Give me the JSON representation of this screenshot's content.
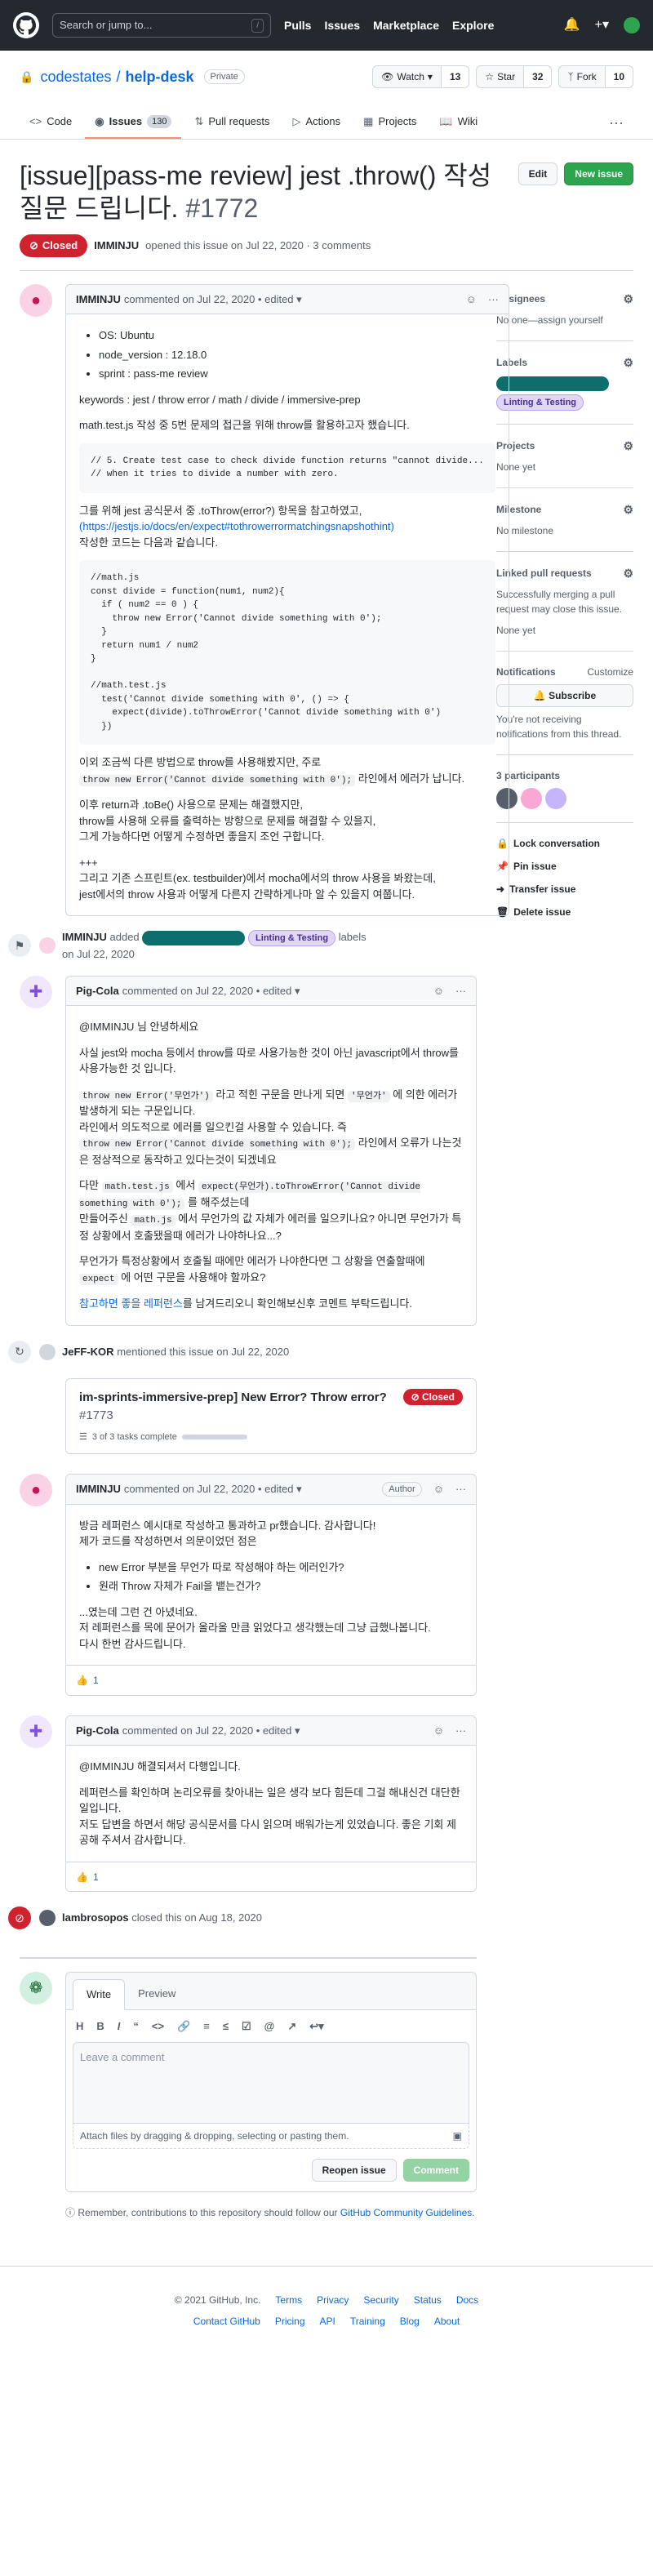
{
  "header": {
    "search_placeholder": "Search or jump to...",
    "search_key": "/",
    "nav": [
      "Pulls",
      "Issues",
      "Marketplace",
      "Explore"
    ]
  },
  "repo": {
    "owner": "codestates",
    "separator": "/",
    "name": "help-desk",
    "visibility": "Private",
    "watch_label": "Watch",
    "watch_count": "13",
    "star_label": "Star",
    "star_count": "32",
    "fork_label": "Fork",
    "fork_count": "10",
    "tabs": [
      {
        "label": "Code"
      },
      {
        "label": "Issues",
        "count": "130"
      },
      {
        "label": "Pull requests"
      },
      {
        "label": "Actions"
      },
      {
        "label": "Projects"
      },
      {
        "label": "Wiki"
      }
    ]
  },
  "issue": {
    "title": "[issue][pass-me review] jest .throw() 작성 질문 드립니다.",
    "number": "#1772",
    "edit_label": "Edit",
    "new_issue_label": "New issue",
    "state": "Closed",
    "author": "IMMINJU",
    "opened_text": "opened this issue on Jul 22, 2020 · 3 comments"
  },
  "comments": [
    {
      "author": "IMMINJU",
      "meta": "commented on Jul 22, 2020 • edited",
      "bullets": [
        "OS: Ubuntu",
        "node_version : 12.18.0",
        "sprint : pass-me review"
      ],
      "p1": "keywords : jest / throw error / math / divide / immersive-prep",
      "p2": "math.test.js 작성 중 5번 문제의 접근을 위해 throw를 활용하고자 했습니다.",
      "code1": "// 5. Create test case to check divide function returns \"cannot divide...\n// when it tries to divide a number with zero.",
      "p3a": "그를 위해 jest 공식문서 중 .toThrow(error?) 항목을 참고하였고,",
      "p3link": "(https://jestjs.io/docs/en/expect#tothrowerrormatchingsnapshothint)",
      "p3b": "작성한 코드는 다음과 같습니다.",
      "code2": "//math.js\nconst divide = function(num1, num2){\n  if ( num2 == 0 ) {\n    throw new Error('Cannot divide something with 0');\n  }\n  return num1 / num2\n}\n\n//math.test.js\n  test('Cannot divide something with 0', () => {\n    expect(divide).toThrowError('Cannot divide something with 0')\n  })",
      "p4a": "이외 조금씩 다른 방법으로 throw를 사용해봤지만, 주로",
      "p4code": "throw new Error('Cannot divide something with 0');",
      "p4b": "라인에서 에러가 납니다.",
      "p5": "이후 return과 .toBe() 사용으로 문제는 해결했지만,\nthrow를 사용해 오류를 출력하는 방향으로 문제를 해결할 수 있을지,\n그게 가능하다면 어떻게 수정하면 좋을지 조언 구합니다.",
      "p6": "+++\n그리고 기존 스프린트(ex. testbuilder)에서 mocha에서의 throw 사용을 봐왔는데,\njest에서의 throw 사용과 어떻게 다른지 간략하게나마 알 수 있을지 여쭙니다."
    },
    {
      "author": "Pig-Cola",
      "meta": "commented on Jul 22, 2020 • edited",
      "p1": "@IMMINJU 님 안녕하세요",
      "p2": "사실 jest와 mocha 등에서 throw를 따로 사용가능한 것이 아닌 javascript에서 throw를 사용가능한 것 입니다.",
      "p3code1": "throw new Error('무언가')",
      "p3a": "라고 적힌 구문을 만나게 되면",
      "p3code2": "'무언가'",
      "p3b": "에 의한 에러가 발생하게 되는 구문입니다.",
      "p3c": "라인에서 의도적으로 에러를 일으킨걸 사용할 수 있습니다. 즉",
      "p3code3": "throw new Error('Cannot divide something with 0');",
      "p3d": "라인에서 오류가 나는것은 정상적으로 동작하고 있다는것이 되겠네요",
      "p4a": "다만",
      "p4code1": "math.test.js",
      "p4b": "에서",
      "p4code2": "expect(무언가).toThrowError('Cannot divide something with 0');",
      "p4c": "를 해주셨는데",
      "p4d": "만들어주신",
      "p4code3": "math.js",
      "p4e": "에서 무언가의 값 자체가 에러를 일으키나요? 아니면 무언가가 특정 상황에서 호출됐을때 에러가 나야하나요...?",
      "p5a": "무언가가 특정상황에서 호출될 때에만 에러가 나야한다면 그 상황을 연출할때에",
      "p5code": "expect",
      "p5b": "에 어떤 구문을 사용해야 할까요?",
      "p6link": "참고하면 좋을 레퍼런스",
      "p6b": "를 남겨드리오니 확인해보신후 코멘트 부탁드립니다."
    },
    {
      "author": "IMMINJU",
      "meta": "commented on Jul 22, 2020 • edited",
      "badge": "Author",
      "p1": "방금 레퍼런스 예시대로 작성하고 통과하고 pr했습니다. 감사합니다!\n제가 코드를 작성하면서 의문이었던 점은",
      "bullets": [
        "new Error 부분을 무언가 따로 작성해야 하는 에러인가?",
        "원래 Throw 자체가 Fail을 뱉는건가?"
      ],
      "p2": "...였는데 그런 건 아녔네요.\n저 레퍼런스를 목에 문어가 올라올 만큼 읽었다고 생각했는데 그냥 급했나봅니다.\n다시 한번 감사드립니다.",
      "reaction": "1"
    },
    {
      "author": "Pig-Cola",
      "meta": "commented on Jul 22, 2020 • edited",
      "p1": "@IMMINJU 해결되셔서 다행입니다.",
      "p2": "레퍼런스를 확인하며 논리오류를 찾아내는 일은 생각 보다 힘든데 그걸 해내신건 대단한 일입니다.\n저도 답변을 하면서 해당 공식문서를 다시 읽으며 배워가는게 있었습니다. 좋은 기회 제공해 주셔서 감사합니다.",
      "reaction": "1"
    }
  ],
  "events": {
    "label_event": {
      "author": "IMMINJU",
      "action": "added",
      "labels": [
        "",
        "Linting & Testing"
      ],
      "suffix": "labels",
      "date": "on Jul 22, 2020"
    },
    "mention": {
      "author": "JeFF-KOR",
      "text": "mentioned this issue on Jul 22, 2020",
      "title": "im-sprints-immersive-prep] New Error? Throw error?",
      "number": "#1773",
      "tasks": "3 of 3 tasks complete",
      "state": "Closed"
    },
    "closed": {
      "author": "lambrosopos",
      "text": "closed this on Aug 18, 2020"
    }
  },
  "sidebar": {
    "assignees_title": "Assignees",
    "assignees_text": "No one—assign yourself",
    "labels_title": "Labels",
    "labels": [
      "",
      "Linting & Testing"
    ],
    "projects_title": "Projects",
    "projects_text": "None yet",
    "milestone_title": "Milestone",
    "milestone_text": "No milestone",
    "linked_title": "Linked pull requests",
    "linked_desc": "Successfully merging a pull request may close this issue.",
    "linked_text": "None yet",
    "notifications_title": "Notifications",
    "customize": "Customize",
    "subscribe": "Subscribe",
    "notif_text": "You're not receiving notifications from this thread.",
    "participants_title": "3 participants",
    "actions": [
      "Lock conversation",
      "Pin issue",
      "Transfer issue",
      "Delete issue"
    ]
  },
  "composer": {
    "tab_write": "Write",
    "tab_preview": "Preview",
    "placeholder": "Leave a comment",
    "attach": "Attach files by dragging & dropping, selecting or pasting them.",
    "reopen": "Reopen issue",
    "comment": "Comment",
    "reminder_a": "Remember, contributions to this repository should follow our",
    "reminder_link": "GitHub Community Guidelines",
    "reminder_b": "."
  },
  "footer": {
    "row1": [
      "© 2021 GitHub, Inc.",
      "Terms",
      "Privacy",
      "Security",
      "Status",
      "Docs"
    ],
    "row2": [
      "Contact GitHub",
      "Pricing",
      "API",
      "Training",
      "Blog",
      "About"
    ]
  }
}
